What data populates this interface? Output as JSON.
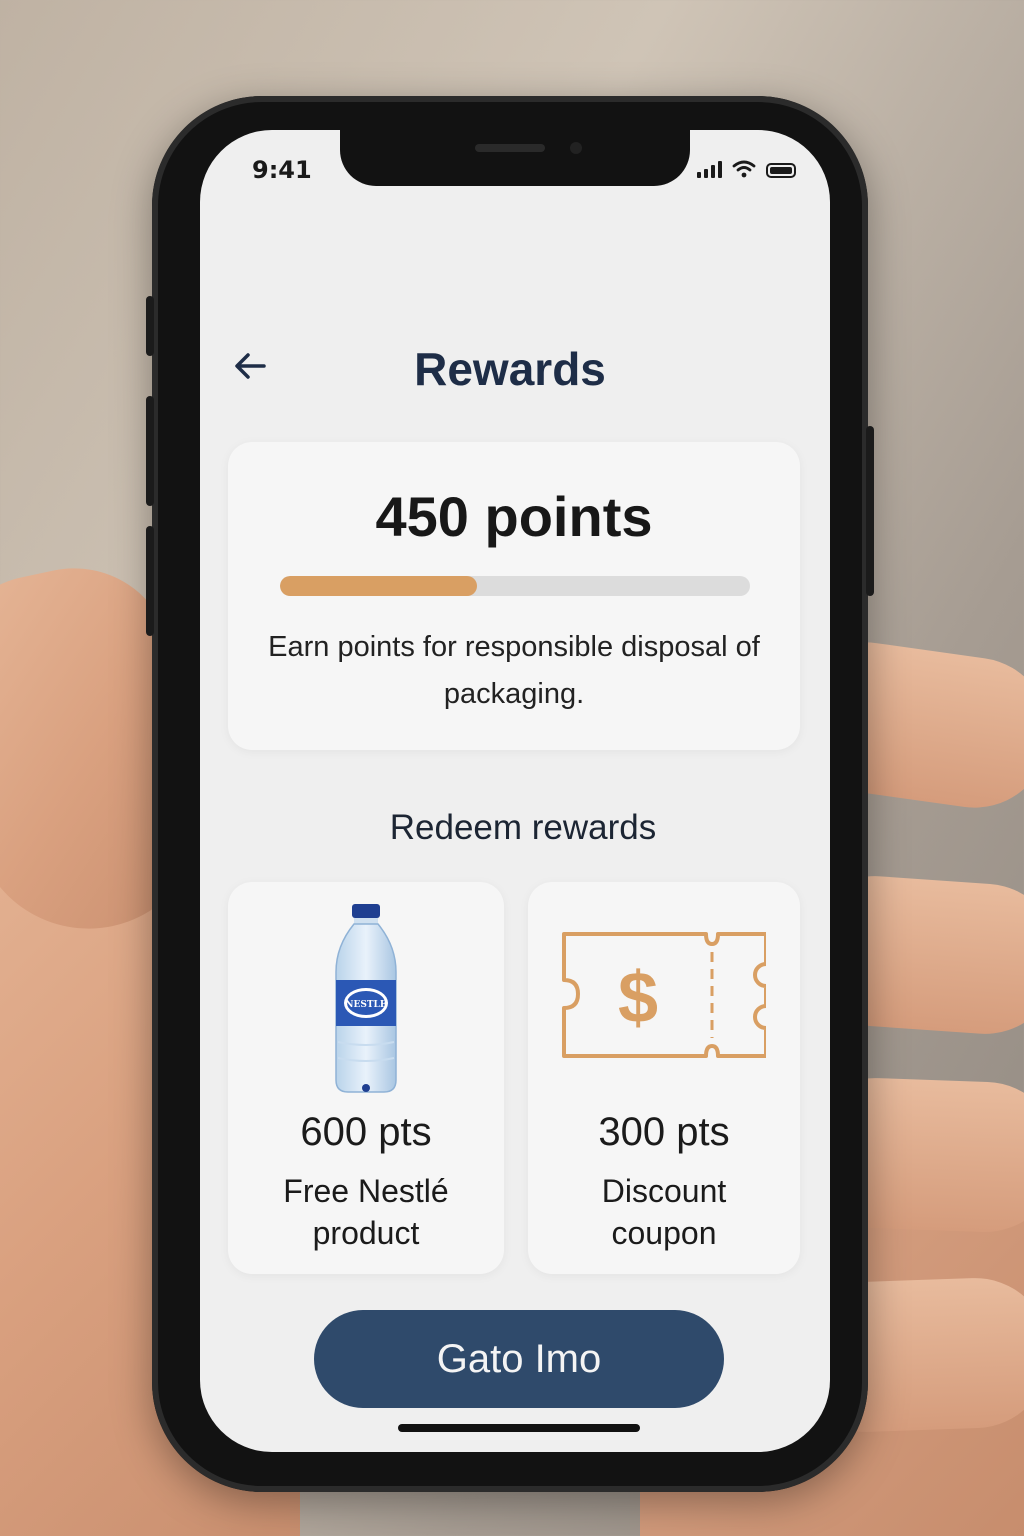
{
  "status_bar": {
    "time": "9:41",
    "icons": [
      "signal-icon",
      "wifi-icon",
      "battery-icon"
    ]
  },
  "header": {
    "back_icon": "arrow-left-icon",
    "title": "Rewards"
  },
  "points_card": {
    "points_label": "450 points",
    "progress_fraction": 0.42,
    "description": "Earn points for responsible disposal of packaging."
  },
  "redeem": {
    "section_title": "Redeem rewards",
    "items": [
      {
        "icon": "water-bottle-icon",
        "points": "600 pts",
        "name": "Free Nestlé product",
        "bottle_label": "NESTLE"
      },
      {
        "icon": "coupon-icon",
        "points": "300 pts",
        "name": "Discount coupon",
        "coupon_symbol": "$"
      }
    ]
  },
  "cta": {
    "label": "Gato Imo"
  },
  "colors": {
    "accent": "#d99f63",
    "primary_button": "#2f4a6b",
    "title_text": "#1e2d47",
    "screen_background": "#efefef",
    "card_background": "#f6f6f6"
  }
}
